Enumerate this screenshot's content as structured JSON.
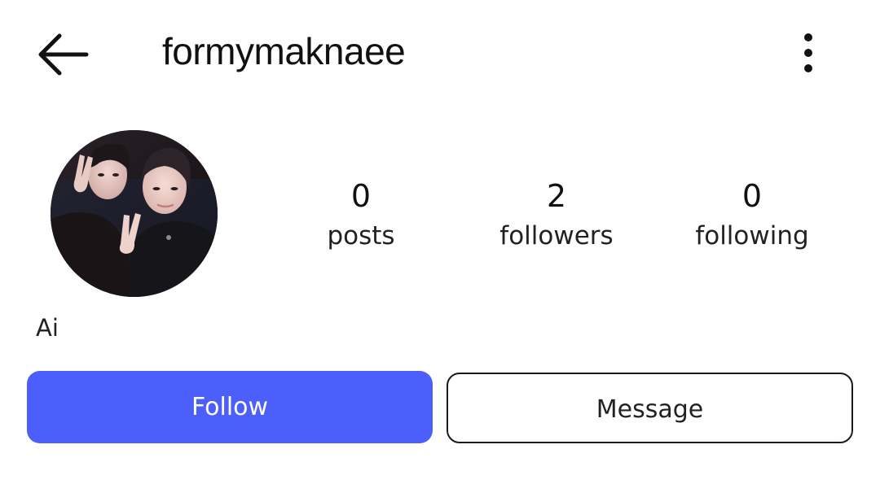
{
  "header": {
    "back_icon": "arrow-left-icon",
    "username": "formymaknaee",
    "more_icon": "more-vertical-icon"
  },
  "profile": {
    "avatar_alt": "profile photo",
    "bio": "Ai"
  },
  "stats": {
    "posts": {
      "count": "0",
      "label": "posts"
    },
    "followers": {
      "count": "2",
      "label": "followers"
    },
    "following": {
      "count": "0",
      "label": "following"
    }
  },
  "actions": {
    "follow_label": "Follow",
    "message_label": "Message"
  },
  "colors": {
    "follow_bg": "#4c5ffb",
    "text": "#111111",
    "background": "#ffffff"
  }
}
